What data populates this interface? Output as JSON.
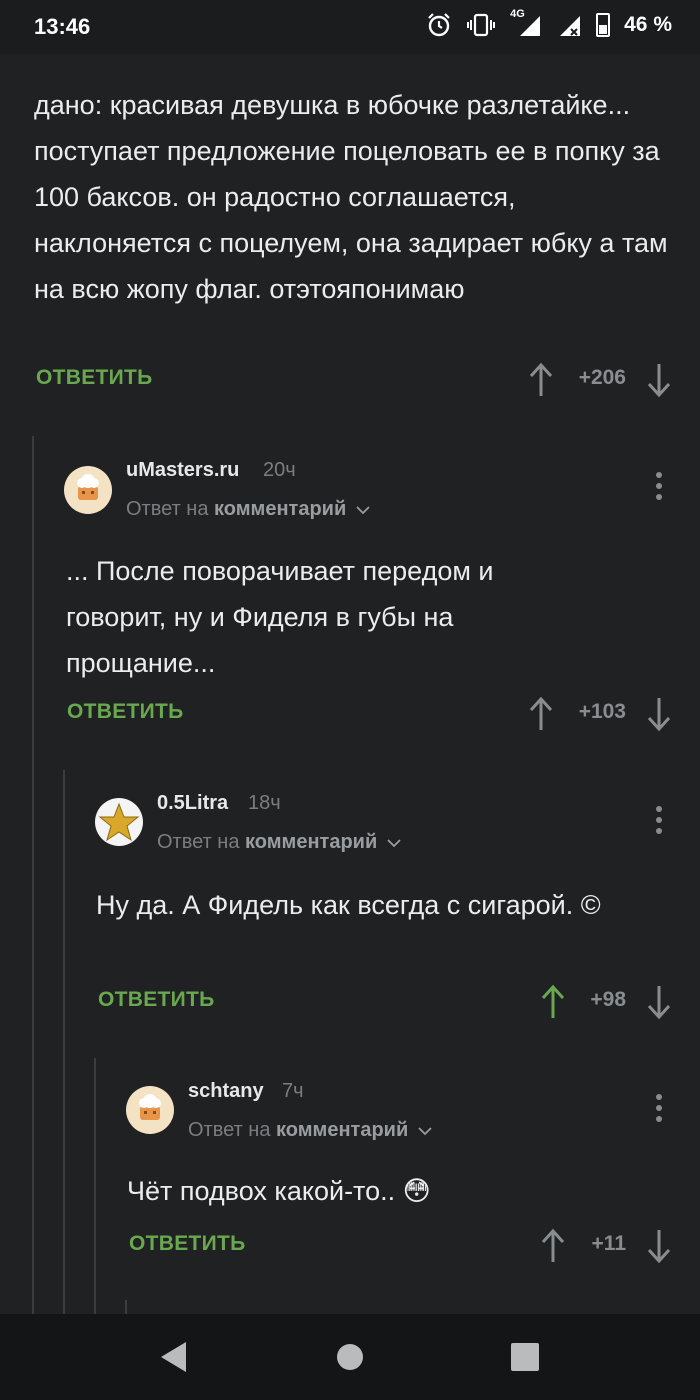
{
  "status_bar": {
    "time": "13:46",
    "network": "4G",
    "battery_percent": "46 %",
    "icons": [
      "alarm-icon",
      "vibrate-icon",
      "signal-4g-icon",
      "signal-no-data-icon",
      "battery-icon"
    ]
  },
  "comments": [
    {
      "text": "дано: красивая девушка в юбочке разлетайке... поступает предложение поцеловать ее в попку за 100 баксов. он радостно соглашается, наклоняется с поцелуем, она задирает юбку а там на всю жопу флаг. отэтояпонимаю",
      "reply_label": "ОТВЕТИТЬ",
      "score": "+206"
    },
    {
      "username": "uMasters.ru",
      "time": "20ч",
      "reply_to_prefix": "Ответ на",
      "reply_to_target": "комментарий",
      "text": "... После поворачивает передом и говорит, ну и Фиделя в губы на прощание...",
      "reply_label": "ОТВЕТИТЬ",
      "score": "+103"
    },
    {
      "username": "0.5Litra",
      "time": "18ч",
      "reply_to_prefix": "Ответ на",
      "reply_to_target": "комментарий",
      "text": "Ну да. А Фидель как всегда с сигарой. ©",
      "reply_label": "ОТВЕТИТЬ",
      "score": "+98"
    },
    {
      "username": "schtany",
      "time": "7ч",
      "reply_to_prefix": "Ответ на",
      "reply_to_target": "комментарий",
      "text": "Чёт подвох какой-то.. 😳",
      "reply_label": "ОТВЕТИТЬ",
      "score": "+11"
    }
  ],
  "colors": {
    "background": "#1f2123",
    "accent_green": "#6aa84f",
    "muted": "#8a8d90"
  }
}
